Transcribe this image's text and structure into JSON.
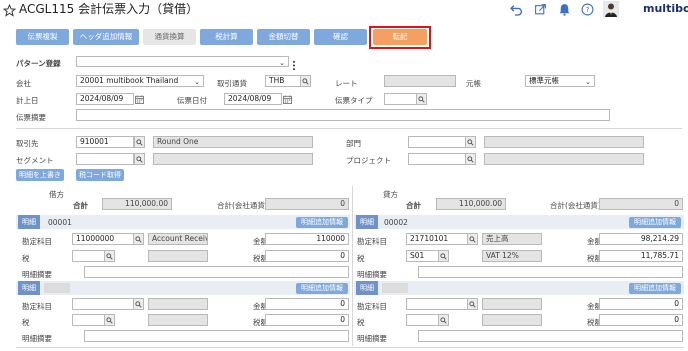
{
  "header": {
    "title": "ACGL115 会計伝票入力（貸借）",
    "brand": "multiboo"
  },
  "toolbar": {
    "buttons": [
      "伝票複製",
      "ヘッダ追加情報",
      "通貨換算",
      "税計算",
      "金額切替",
      "確認",
      "転記"
    ]
  },
  "form": {
    "pattern_label": "パターン登録",
    "pattern_value": "",
    "company_label": "会社",
    "company_value": "20001 multibook Thailand",
    "currency_label": "取引通貨",
    "currency_value": "THB",
    "rate_label": "レート",
    "rate_value": "",
    "ledger_label": "元帳",
    "ledger_value": "標準元帳",
    "posting_date_label": "計上日",
    "posting_date_value": "2024/08/09",
    "voucher_date_label": "伝票日付",
    "voucher_date_value": "2024/08/09",
    "voucher_type_label": "伝票タイプ",
    "voucher_type_value": "",
    "summary_label": "伝票摘要",
    "summary_value": ""
  },
  "partner": {
    "partner_label": "取引先",
    "partner_code": "910001",
    "partner_name": "Round One",
    "dept_label": "部門",
    "segment_label": "セグメント",
    "project_label": "プロジェクト",
    "btn_copy": "明細を上書き",
    "btn_tax": "税コード取得"
  },
  "debit": {
    "side_label": "借方",
    "total_label": "合計",
    "total_value": "110,000.00",
    "total_company_label": "合計(会社通貨)",
    "total_company_value": "0",
    "rows": [
      {
        "tag": "明細",
        "no": "00001",
        "add_info": "明細追加情報",
        "account_label": "勘定科目",
        "account_code": "11000000",
        "account_name": "Account Receiva",
        "amount_label": "金額",
        "amount": "110000",
        "tax_label": "税",
        "tax_code": "",
        "tax_name": "",
        "tax_amount_label": "税額",
        "tax_amount": "0",
        "memo_label": "明細摘要",
        "memo": ""
      },
      {
        "tag": "明細",
        "no": "",
        "add_info": "明細追加情報",
        "account_label": "勘定科目",
        "account_code": "",
        "account_name": "",
        "amount_label": "金額",
        "amount": "0",
        "tax_label": "税",
        "tax_code": "",
        "tax_name": "",
        "tax_amount_label": "税額",
        "tax_amount": "0",
        "memo_label": "明細摘要",
        "memo": ""
      }
    ]
  },
  "credit": {
    "side_label": "貸方",
    "total_label": "合計",
    "total_value": "110,000.00",
    "total_company_label": "合計(会社通貨)",
    "total_company_value": "0",
    "rows": [
      {
        "tag": "明細",
        "no": "00002",
        "add_info": "明細追加情報",
        "account_label": "勘定科目",
        "account_code": "21710101",
        "account_name": "売上高",
        "amount_label": "金額",
        "amount": "98,214.29",
        "tax_label": "税",
        "tax_code": "S01",
        "tax_name": "VAT 12%",
        "tax_amount_label": "税額",
        "tax_amount": "11,785.71",
        "memo_label": "明細摘要",
        "memo": ""
      },
      {
        "tag": "明細",
        "no": "",
        "add_info": "明細追加情報",
        "account_label": "勘定科目",
        "account_code": "",
        "account_name": "",
        "amount_label": "金額",
        "amount": "0",
        "tax_label": "税",
        "tax_code": "",
        "tax_name": "",
        "tax_amount_label": "税額",
        "tax_amount": "0",
        "memo_label": "明細摘要",
        "memo": ""
      }
    ]
  },
  "colors": {
    "button": "#7fa8dc",
    "post_button": "#f5a061",
    "highlight_border": "#e0131b",
    "readonly": "#e4e4e4",
    "header_icon": "#3f6fc7"
  },
  "icons": [
    "star-icon",
    "undo-icon",
    "external-link-icon",
    "bell-icon",
    "help-icon",
    "user-avatar",
    "search-icon",
    "calendar-icon",
    "dropdown-icon",
    "more-icon"
  ]
}
